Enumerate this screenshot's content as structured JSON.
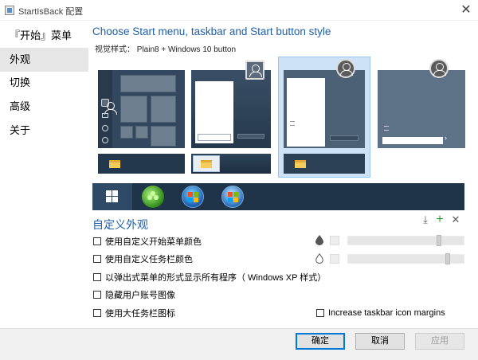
{
  "window": {
    "title": "StartIsBack 配置",
    "close_glyph": "✕"
  },
  "sidebar": {
    "items": [
      {
        "label": "『开始』菜单"
      },
      {
        "label": "外观"
      },
      {
        "label": "切换"
      },
      {
        "label": "高级"
      },
      {
        "label": "关于"
      }
    ],
    "active_index": 1
  },
  "main": {
    "heading": "Choose Start menu, taskbar and Start button style",
    "visual_style": "视觉样式： Plain8 + Windows 10 button",
    "selected_thumbnail_index": 2,
    "start_button_styles": [
      "windows-10-logo",
      "clover-orb",
      "windows-7-orb",
      "windows-vista-orb"
    ],
    "selected_button_index": 0
  },
  "custom_appearance": {
    "title": "自定义外观",
    "toolbar_icons": [
      "download-icon",
      "plus-icon",
      "close-icon"
    ],
    "options": [
      {
        "label": "使用自定义开始菜单颜色",
        "checked": false
      },
      {
        "label": "使用自定义任务栏颜色",
        "checked": false
      },
      {
        "label": "以弹出式菜单的形式显示所有程序（ Windows XP 样式）",
        "checked": false
      },
      {
        "label": "隐藏用户账号图像",
        "checked": false
      },
      {
        "label": "使用大任务栏图标",
        "checked": false
      }
    ],
    "increase_margins": {
      "label": "Increase taskbar icon margins",
      "checked": false
    },
    "start_menu_slider_value": 0.8,
    "taskbar_slider_value": 0.88
  },
  "buttons": {
    "ok": "确定",
    "cancel": "取消",
    "apply": "应用",
    "apply_enabled": false
  },
  "colors": {
    "accent": "#1f5fa8",
    "selection": "#cde2f7",
    "strip": "#203449"
  }
}
